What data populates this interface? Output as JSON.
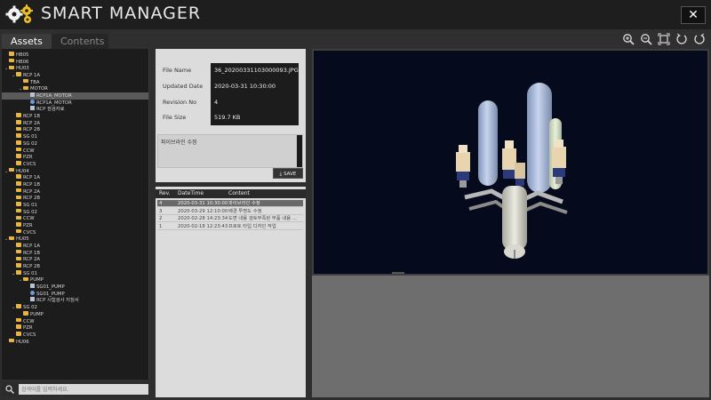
{
  "app": {
    "title": "SMART MANAGER",
    "close_label": "✕"
  },
  "tabs": [
    {
      "label": "Assets"
    },
    {
      "label": "Contents"
    }
  ],
  "toolbar": {
    "icons": [
      "zoom-in-icon",
      "zoom-out-icon",
      "fit-icon",
      "rotate-left-icon",
      "rotate-right-icon"
    ]
  },
  "tree": [
    {
      "label": "HB05",
      "depth": 0,
      "kind": "folder"
    },
    {
      "label": "HB06",
      "depth": 0,
      "kind": "folder"
    },
    {
      "label": "HU03",
      "depth": 0,
      "kind": "folder",
      "expanded": true
    },
    {
      "label": "RCP 1A",
      "depth": 1,
      "kind": "folder",
      "expanded": true
    },
    {
      "label": "TBA",
      "depth": 2,
      "kind": "folder"
    },
    {
      "label": "MOTOR",
      "depth": 2,
      "kind": "folder",
      "expanded": true
    },
    {
      "label": "RCP1A_MOTOR",
      "depth": 3,
      "kind": "doc",
      "selected": true
    },
    {
      "label": "RCP1A_MOTOR",
      "depth": 3,
      "kind": "model"
    },
    {
      "label": "RCP 점검자료",
      "depth": 3,
      "kind": "doc"
    },
    {
      "label": "RCP 1B",
      "depth": 1,
      "kind": "folder"
    },
    {
      "label": "RCP 2A",
      "depth": 1,
      "kind": "folder"
    },
    {
      "label": "RCP 2B",
      "depth": 1,
      "kind": "folder"
    },
    {
      "label": "SG 01",
      "depth": 1,
      "kind": "folder"
    },
    {
      "label": "SG 02",
      "depth": 1,
      "kind": "folder"
    },
    {
      "label": "CCW",
      "depth": 1,
      "kind": "folder"
    },
    {
      "label": "PZR",
      "depth": 1,
      "kind": "folder"
    },
    {
      "label": "CVCS",
      "depth": 1,
      "kind": "folder"
    },
    {
      "label": "HU04",
      "depth": 0,
      "kind": "folder",
      "expanded": true
    },
    {
      "label": "RCP 1A",
      "depth": 1,
      "kind": "folder"
    },
    {
      "label": "RCP 1B",
      "depth": 1,
      "kind": "folder"
    },
    {
      "label": "RCP 2A",
      "depth": 1,
      "kind": "folder"
    },
    {
      "label": "RCP 2B",
      "depth": 1,
      "kind": "folder"
    },
    {
      "label": "SG 01",
      "depth": 1,
      "kind": "folder"
    },
    {
      "label": "SG 02",
      "depth": 1,
      "kind": "folder"
    },
    {
      "label": "CCW",
      "depth": 1,
      "kind": "folder"
    },
    {
      "label": "PZR",
      "depth": 1,
      "kind": "folder"
    },
    {
      "label": "CVCS",
      "depth": 1,
      "kind": "folder"
    },
    {
      "label": "HU05",
      "depth": 0,
      "kind": "folder",
      "expanded": true
    },
    {
      "label": "RCP 1A",
      "depth": 1,
      "kind": "folder"
    },
    {
      "label": "RCP 1B",
      "depth": 1,
      "kind": "folder"
    },
    {
      "label": "RCP 2A",
      "depth": 1,
      "kind": "folder"
    },
    {
      "label": "RCP 2B",
      "depth": 1,
      "kind": "folder"
    },
    {
      "label": "SG 01",
      "depth": 1,
      "kind": "folder",
      "expanded": true
    },
    {
      "label": "PUMP",
      "depth": 2,
      "kind": "folder",
      "expanded": true
    },
    {
      "label": "SG01_PUMP",
      "depth": 3,
      "kind": "doc"
    },
    {
      "label": "SG01_PUMP",
      "depth": 3,
      "kind": "model"
    },
    {
      "label": "RCP 시험검사 지침서",
      "depth": 3,
      "kind": "doc"
    },
    {
      "label": "SG 02",
      "depth": 1,
      "kind": "folder",
      "expanded": true
    },
    {
      "label": "PUMP",
      "depth": 2,
      "kind": "folder"
    },
    {
      "label": "CCW",
      "depth": 1,
      "kind": "folder"
    },
    {
      "label": "PZR",
      "depth": 1,
      "kind": "folder"
    },
    {
      "label": "CVCS",
      "depth": 1,
      "kind": "folder"
    },
    {
      "label": "HU06",
      "depth": 0,
      "kind": "folder"
    }
  ],
  "search": {
    "placeholder": "검색어를 입력하세요."
  },
  "info": {
    "file_name_label": "File Name",
    "file_name": "36_20200331103000093.JPG",
    "updated_date_label": "Updated Date",
    "updated_date": "2020-03-31 10:30:00",
    "revision_label": "Revision No",
    "revision": "4",
    "file_size_label": "File Size",
    "file_size": "519.7 KB",
    "memo": "파이브라인 수정",
    "save_label": "SAVE"
  },
  "revisions": {
    "headers": [
      "Rev.",
      "DateTime",
      "Content"
    ],
    "rows": [
      {
        "rev": "4",
        "datetime": "2020-03-31 10:30:00",
        "content": "파이브라인 수정",
        "selected": true
      },
      {
        "rev": "3",
        "datetime": "2020-03-29 12:10:00",
        "content": "배경 투명도 수정"
      },
      {
        "rev": "2",
        "datetime": "2020-02-28 14:23:34",
        "content": "도면 내용 검토부족된 부품 내용 ..."
      },
      {
        "rev": "1",
        "datetime": "2020-02-18 12:23:43",
        "content": "프로토 타입 디자인 작업"
      }
    ]
  }
}
